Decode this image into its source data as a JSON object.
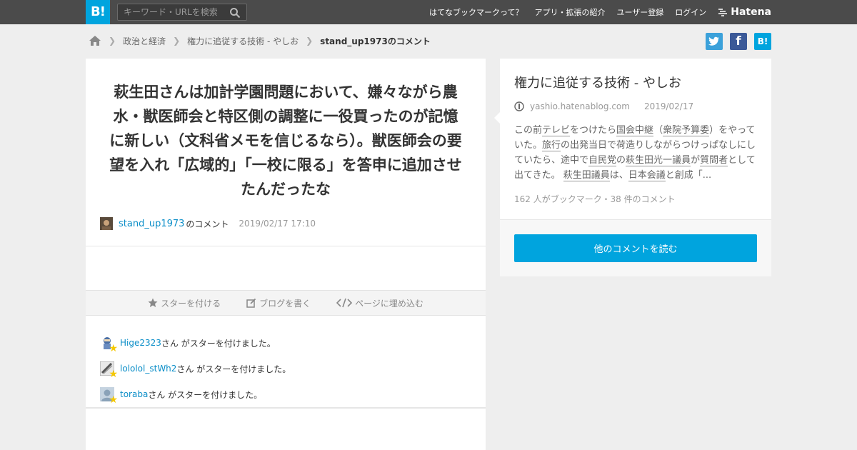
{
  "header": {
    "logo": "B!",
    "search_placeholder": "キーワード・URLを検索",
    "nav": [
      "はてなブックマークって？",
      "アプリ・拡張の紹介",
      "ユーザー登録",
      "ログイン"
    ],
    "brand": "Hatena"
  },
  "breadcrumb": {
    "items": [
      "政治と経済",
      "権力に追従する技術 - やしお"
    ],
    "current": "stand_up1973のコメント"
  },
  "share": {
    "hatena_label": "B!"
  },
  "comment": {
    "text": "萩生田さんは加計学園問題において、嫌々ながら農水・獣医師会と特区側の調整に一役買ったのが記憶に新しい（文科省メモを信じるなら）。獣医師会の要望を入れ「広域的」「一校に限る」を答申に追加させたんだったな",
    "user": "stand_up1973",
    "user_suffix": "のコメント",
    "date": "2019/02/17 17:10"
  },
  "actions": {
    "star": "スターを付ける",
    "blog": "ブログを書く",
    "embed": "ページに埋め込む"
  },
  "stars": [
    {
      "user": "Hige2323",
      "text": "さん がスターを付けました。"
    },
    {
      "user": "lololol_stWh2",
      "text": "さん がスターを付けました。"
    },
    {
      "user": "toraba",
      "text": "さん がスターを付けました。"
    }
  ],
  "entry": {
    "title": "権力に追従する技術 - やしお",
    "domain": "yashio.hatenablog.com",
    "date": "2019/02/17",
    "excerpt": [
      "この前",
      "テレビ",
      "をつけたら",
      "国会中継",
      "（",
      "衆院予算委",
      "）をやっていた。",
      "旅行",
      "の出発当日で荷造りしながらつけっぱなしにしていたら、途中で",
      "自民党",
      "の",
      "萩生田光一",
      "議員",
      "が",
      "質問者",
      "として出てきた。 ",
      "萩生田議員",
      "は、",
      "日本会議",
      "と創成「..."
    ],
    "stats": "162 人がブックマーク・38 件のコメント",
    "read_button": "他のコメントを読む"
  },
  "colors": {
    "accent": "#00a4de",
    "header_bg": "#4b4b4b",
    "link": "#0b8ec8",
    "star": "#f5c800"
  }
}
